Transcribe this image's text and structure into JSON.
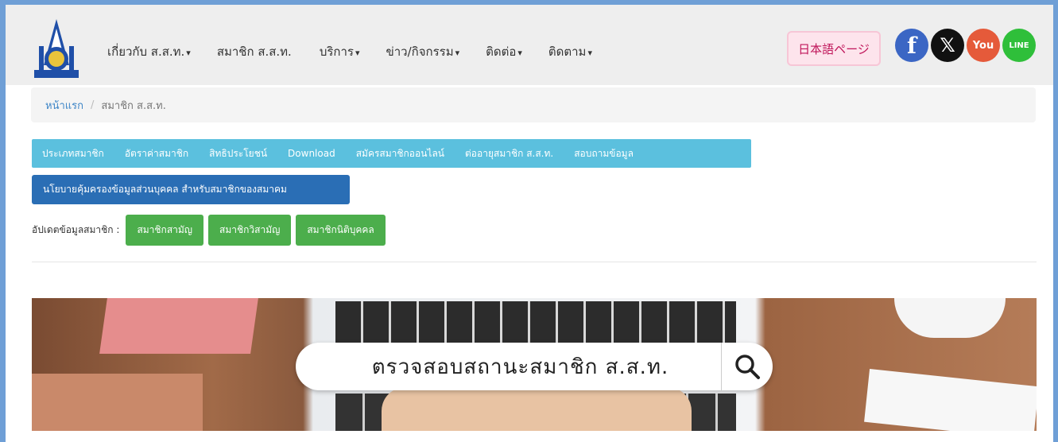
{
  "nav": {
    "items": [
      {
        "label": "เกี่ยวกับ ส.ส.ท.",
        "caret": "▾"
      },
      {
        "label": "สมาชิก ส.ส.ท.",
        "caret": ""
      },
      {
        "label": "บริการ",
        "caret": "▾"
      },
      {
        "label": "ข่าว/กิจกรรม",
        "caret": "▾"
      },
      {
        "label": "ติดต่อ",
        "caret": "▾"
      },
      {
        "label": "ติดตาม",
        "caret": "▾"
      }
    ],
    "japanese_link": "日本語ページ",
    "social": {
      "facebook": "f",
      "x": "𝕏",
      "youtube": "You",
      "line": "LINE"
    }
  },
  "breadcrumb": {
    "home": "หน้าแรก",
    "separator": "/",
    "current": "สมาชิก ส.ส.ท."
  },
  "tabs": [
    "ประเภทสมาชิก",
    "อัตราค่าสมาชิก",
    "สิทธิประโยชน์",
    "Download",
    "สมัครสมาชิกออนไลน์",
    "ต่ออายุสมาชิก ส.ส.ท.",
    "สอบถามข้อมูล"
  ],
  "policy_button": "นโยบายคุ้มครองข้อมูลส่วนบุคคล สำหรับสมาชิกของสมาคม",
  "update": {
    "label": "อัปเดตข้อมูลสมาชิก :",
    "buttons": [
      "สมาชิกสามัญ",
      "สมาชิกวิสามัญ",
      "สมาชิกนิติบุคคล"
    ]
  },
  "banner": {
    "search_text": "ตรวจสอบสถานะสมาชิก ส.ส.ท."
  },
  "colors": {
    "tabbar": "#5bc0de",
    "policy": "#2a6eb5",
    "green": "#4cae4c",
    "link": "#3f86c7"
  }
}
